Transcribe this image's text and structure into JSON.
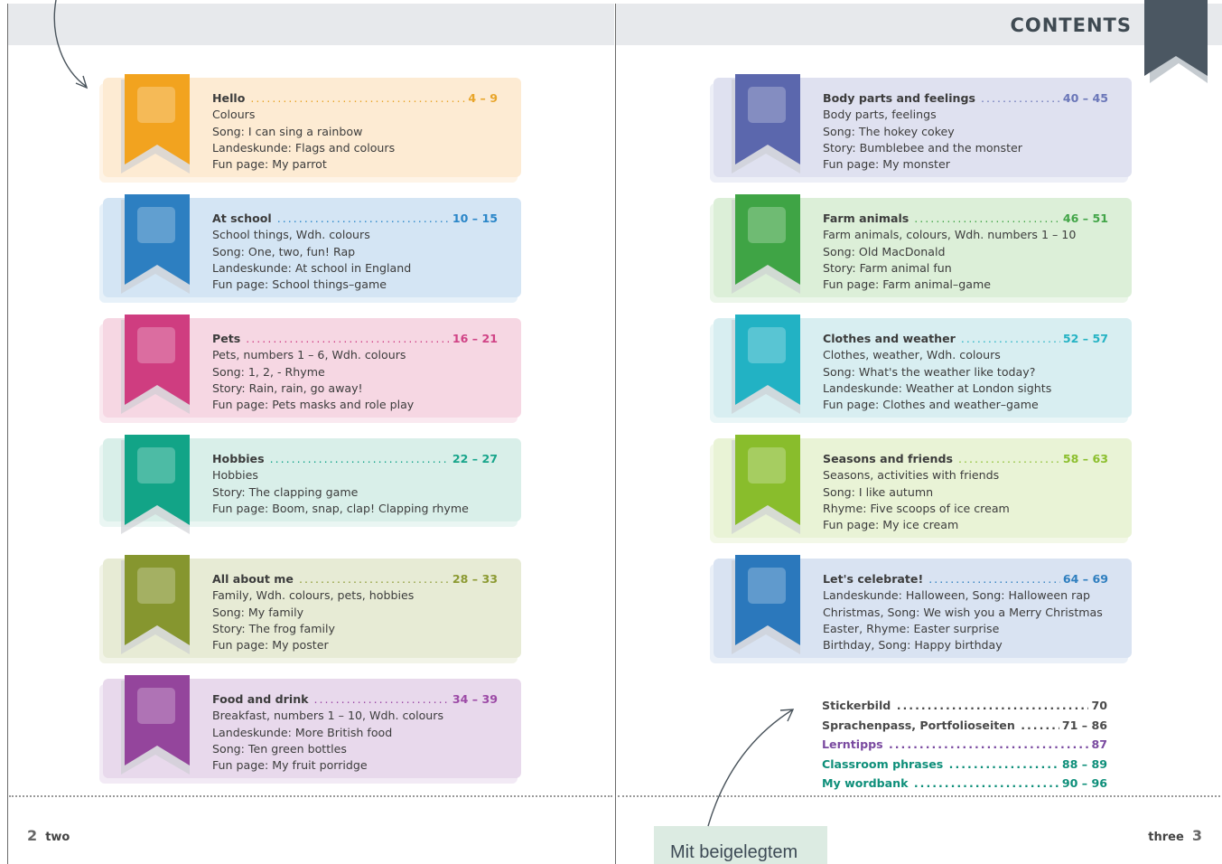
{
  "header": {
    "contents_label": "CONTENTS"
  },
  "left_page": {
    "page_number": "2",
    "page_word": "two",
    "units": [
      {
        "title": "Hello",
        "pages": "4 – 9",
        "accent": "#e8a52a",
        "bg": "#fdebd3",
        "ribbon": "#f2a31f",
        "lines": [
          "Colours",
          "Song: I can sing a rainbow",
          "Landeskunde: Flags and colours",
          "Fun page: My parrot"
        ]
      },
      {
        "title": "At school",
        "pages": "10 – 15",
        "accent": "#2a86c8",
        "bg": "#d4e5f4",
        "ribbon": "#2d7fc1",
        "lines": [
          "School things, Wdh. colours",
          "Song: One, two, fun! Rap",
          "Landeskunde: At school in England",
          "Fun page: School things–game"
        ]
      },
      {
        "title": "Pets",
        "pages": "16 – 21",
        "accent": "#d04386",
        "bg": "#f6d7e3",
        "ribbon": "#cf3d80",
        "lines": [
          "Pets, numbers 1 – 6, Wdh. colours",
          "Song: 1, 2, - Rhyme",
          "Story: Rain, rain, go away!",
          "Fun page: Pets masks and role play"
        ]
      },
      {
        "title": "Hobbies",
        "pages": "22 – 27",
        "accent": "#18a58b",
        "bg": "#d9efe9",
        "ribbon": "#12a487",
        "lines": [
          "Hobbies",
          "Story: The clapping game",
          "Fun page: Boom, snap, clap! Clapping rhyme"
        ]
      },
      {
        "title": "All about me",
        "pages": "28 – 33",
        "accent": "#8c9a32",
        "bg": "#e7ebd5",
        "ribbon": "#86962f",
        "lines": [
          "Family, Wdh. colours, pets, hobbies",
          "Song: My family",
          "Story: The frog family",
          "Fun page: My poster"
        ]
      },
      {
        "title": "Food and drink",
        "pages": "34 – 39",
        "accent": "#9c4aa6",
        "bg": "#e8d9ec",
        "ribbon": "#94459c",
        "lines": [
          "Breakfast, numbers 1 – 10, Wdh. colours",
          "Landeskunde: More British food",
          "Song: Ten green bottles",
          "Fun page: My fruit porridge"
        ]
      }
    ]
  },
  "right_page": {
    "page_number": "3",
    "page_word": "three",
    "units": [
      {
        "title": "Body parts and feelings",
        "pages": "40 – 45",
        "accent": "#6a76b8",
        "bg": "#dfe1f0",
        "ribbon": "#5b67ad",
        "lines": [
          "Body parts, feelings",
          "Song: The hokey cokey",
          "Story: Bumblebee and the monster",
          "Fun page: My monster"
        ]
      },
      {
        "title": "Farm animals",
        "pages": "46 – 51",
        "accent": "#42a548",
        "bg": "#dcefd8",
        "ribbon": "#3fa445",
        "lines": [
          "Farm animals, colours, Wdh. numbers 1 – 10",
          "Song: Old MacDonald",
          "Story: Farm animal fun",
          "Fun page: Farm animal–game"
        ]
      },
      {
        "title": "Clothes and weather",
        "pages": "52 – 57",
        "accent": "#25b3c4",
        "bg": "#d8eef1",
        "ribbon": "#22b2c4",
        "lines": [
          "Clothes, weather, Wdh. colours",
          "Song: What's the weather like today?",
          "Landeskunde: Weather at London sights",
          "Fun page: Clothes and weather–game"
        ]
      },
      {
        "title": "Seasons and friends",
        "pages": "58 – 63",
        "accent": "#8cbf2e",
        "bg": "#e9f3d6",
        "ribbon": "#89bd2c",
        "lines": [
          "Seasons, activities with friends",
          "Song: I like autumn",
          "Rhyme: Five scoops of ice cream",
          "Fun page: My ice cream"
        ]
      },
      {
        "title": "Let's celebrate!",
        "pages": "64 – 69",
        "accent": "#2f7fbf",
        "bg": "#d9e3f2",
        "ribbon": "#2b78bc",
        "lines": [
          "Landeskunde: Halloween, Song: Halloween rap",
          "Christmas, Song: We wish you a Merry Christmas",
          "Easter, Rhyme: Easter surprise",
          "Birthday, Song: Happy birthday"
        ]
      }
    ],
    "extras": [
      {
        "label": "Stickerbild",
        "pages": "70",
        "color": "#4a4a4a"
      },
      {
        "label": "Sprachenpass, Portfolioseiten",
        "pages": "71 – 86",
        "color": "#4a4a4a"
      },
      {
        "label": "Lerntipps",
        "pages": "87",
        "color": "#7a4aa0"
      },
      {
        "label": "Classroom phrases",
        "pages": "88 – 89",
        "color": "#0e8f7a"
      },
      {
        "label": "My wordbank",
        "pages": "90 – 96",
        "color": "#0e8f7a"
      }
    ]
  },
  "sticky_note": {
    "text": "Mit beigelegtem"
  }
}
